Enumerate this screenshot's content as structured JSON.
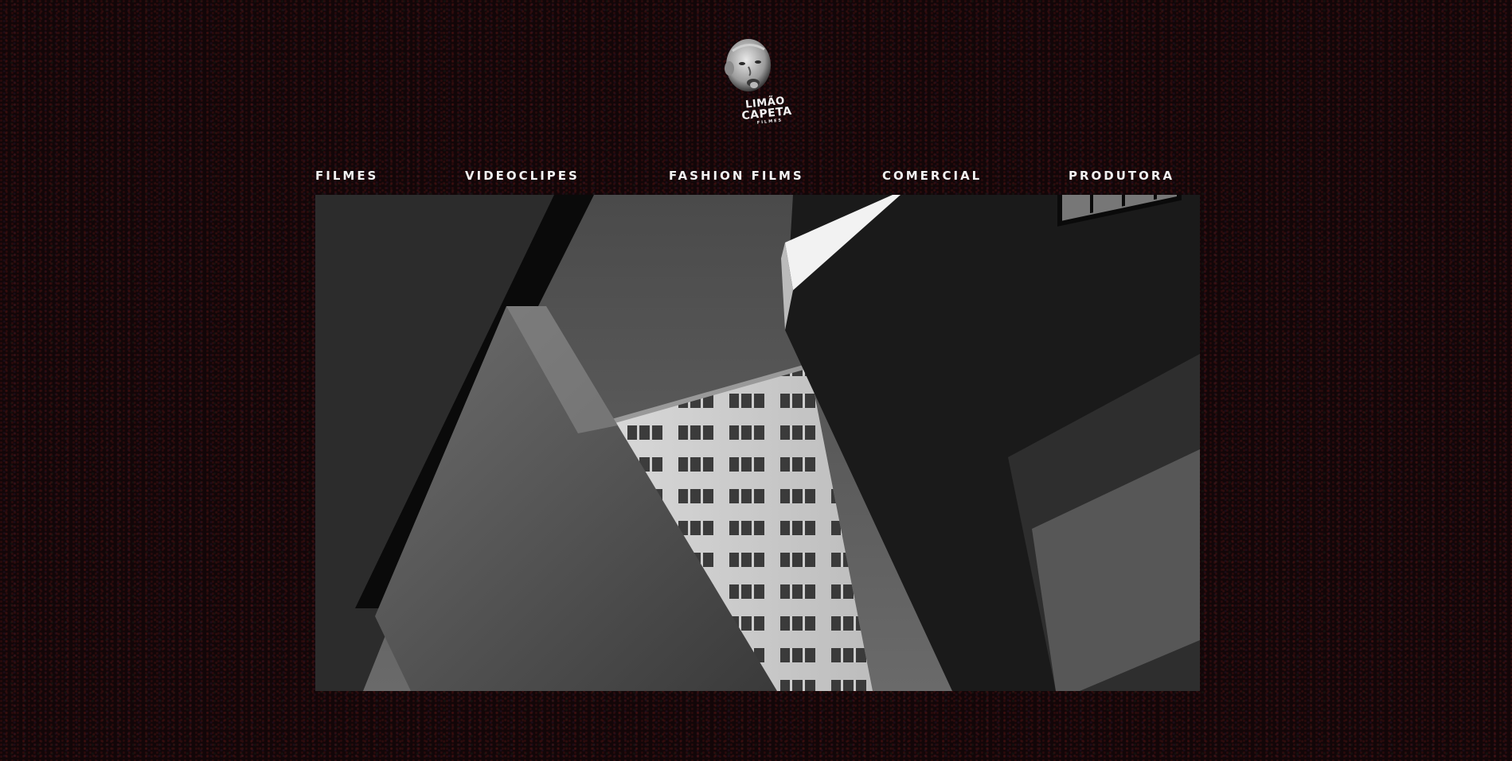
{
  "brand": {
    "logo_line1": "LIMÃO",
    "logo_line2": "CAPETA",
    "logo_line3": "FILMES"
  },
  "nav": {
    "items": [
      {
        "label": "FILMES"
      },
      {
        "label": "VIDEOCLIPES"
      },
      {
        "label": "FASHION FILMS"
      },
      {
        "label": "COMERCIAL"
      },
      {
        "label": "PRODUTORA"
      }
    ]
  },
  "hero": {
    "icon": "building-photo-bw"
  },
  "colors": {
    "background": "#120608",
    "nav_text": "#f2f2f2"
  }
}
